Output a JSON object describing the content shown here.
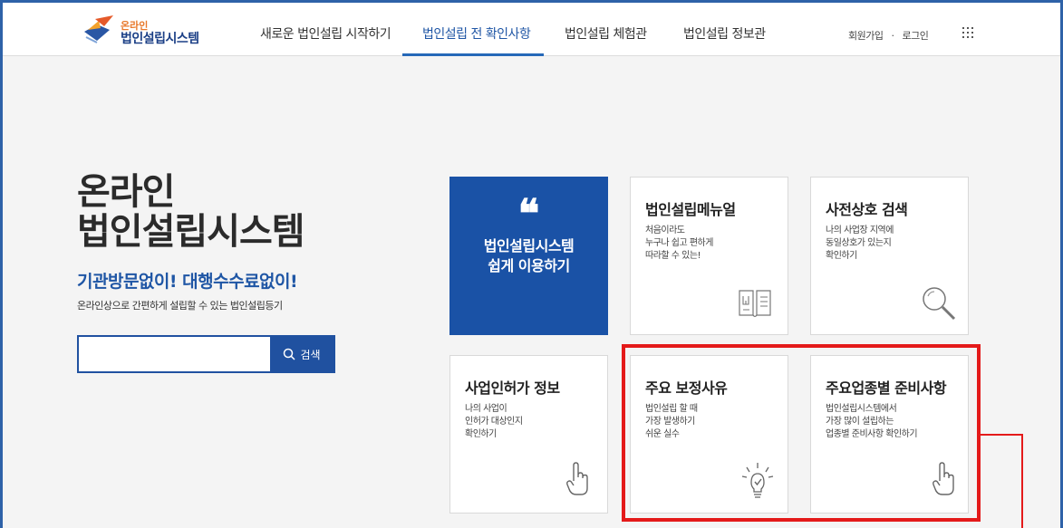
{
  "logo": {
    "small": "온라인",
    "big": "법인설립시스템"
  },
  "nav": [
    {
      "label": "새로운 법인설립 시작하기"
    },
    {
      "label": "법인설립 전 확인사항"
    },
    {
      "label": "법인설립 체험관"
    },
    {
      "label": "법인설립 정보관"
    }
  ],
  "util": {
    "join": "회원가입",
    "sep": "·",
    "login": "로그인"
  },
  "hero": {
    "title_line1": "온라인",
    "title_line2": "법인설립시스템",
    "subtitle": "기관방문없이! 대행수수료없이!",
    "desc": "온라인상으로 간편하게 설립할 수 있는 법인설립등기"
  },
  "search": {
    "value": "",
    "button_label": "검색"
  },
  "featured": {
    "quote": "❝",
    "line1": "법인설립시스템",
    "line2": "쉽게 이용하기"
  },
  "cards": [
    {
      "title": "법인설립메뉴얼",
      "lines": [
        "처음이라도",
        "누구나 쉽고 편하게",
        "따라할 수 있는!"
      ],
      "icon": "book-icon"
    },
    {
      "title": "사전상호 검색",
      "lines": [
        "나의 사업장 지역에",
        "동일상호가 있는지",
        "확인하기"
      ],
      "icon": "magnifier-icon"
    },
    {
      "title": "사업인허가 정보",
      "lines": [
        "나의 사업이",
        "인허가 대상인지",
        "확인하기"
      ],
      "icon": "hand-pointer-icon"
    },
    {
      "title": "주요 보정사유",
      "lines": [
        "법인설립 할 때",
        "가장 발생하기",
        "쉬운 실수"
      ],
      "icon": "lightbulb-icon"
    },
    {
      "title": "주요업종별 준비사항",
      "lines": [
        "법인설립시스템에서",
        "가장 많이 설립하는",
        "업종별 준비사항 확인하기"
      ],
      "icon": "hand-pointer-icon"
    }
  ],
  "colors": {
    "primary": "#1a52a6",
    "accent": "#e41a1a",
    "background": "#f4f4f4"
  }
}
